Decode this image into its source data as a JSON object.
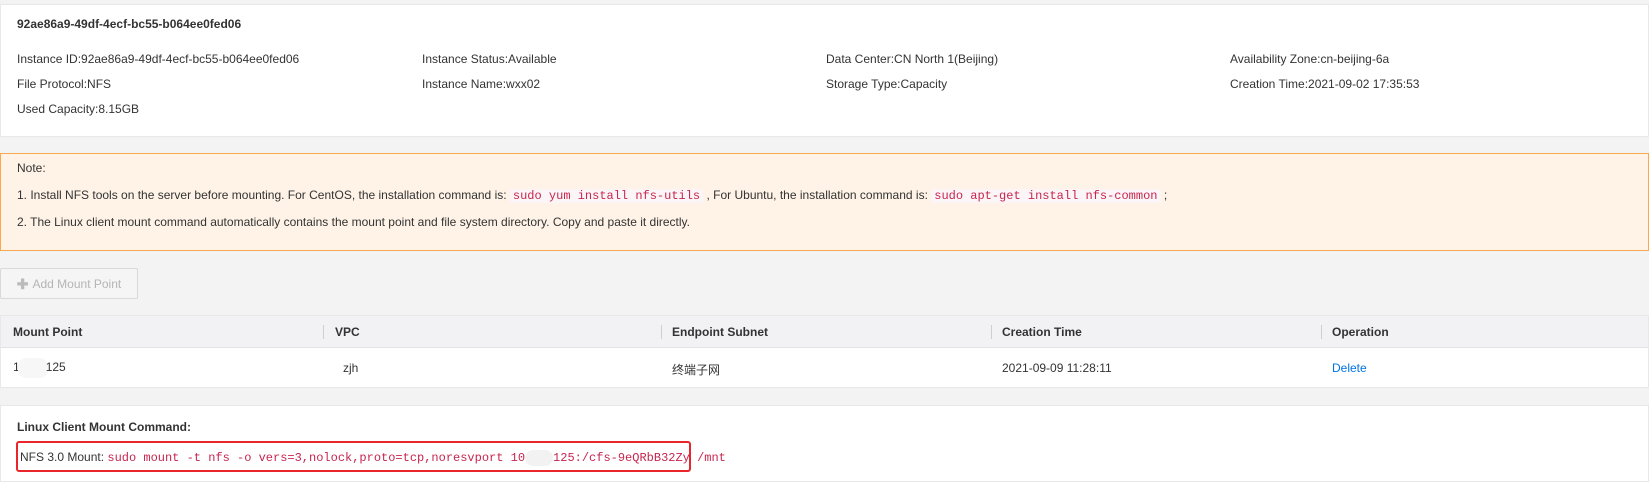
{
  "instance": {
    "title": "92ae86a9-49df-4ecf-bc55-b064ee0fed06",
    "instance_id": "Instance ID:92ae86a9-49df-4ecf-bc55-b064ee0fed06",
    "status": "Instance Status:Available",
    "data_center": "Data Center:CN North 1(Beijing)",
    "availability_zone": "Availability Zone:cn-beijing-6a",
    "file_protocol": "File Protocol:NFS",
    "instance_name": "Instance Name:wxx02",
    "storage_type": "Storage Type:Capacity",
    "creation_time": "Creation Time:2021-09-02 17:35:53",
    "used_capacity": "Used Capacity:8.15GB"
  },
  "note": {
    "heading": "Note:",
    "line1_prefix": "1. Install NFS tools on the server before mounting. For CentOS, the installation command is: ",
    "line1_cmd1": "sudo yum install nfs-utils",
    "line1_mid": " , For Ubuntu, the installation command is: ",
    "line1_cmd2": "sudo apt-get install nfs-common",
    "line1_suffix": " ;",
    "line2": "2. The Linux client mount command automatically contains the mount point and file system directory. Copy and paste it directly."
  },
  "toolbar": {
    "add_mount_point_label": "Add Mount Point",
    "add_icon": "plus-icon"
  },
  "table": {
    "headers": [
      "Mount Point",
      "VPC",
      "Endpoint Subnet",
      "Creation Time",
      "Operation"
    ],
    "rows": [
      {
        "mount_point_start": "1",
        "mount_point_end": "125",
        "vpc": "zjh",
        "subnet": "终端子网",
        "creation_time": "2021-09-09 11:28:11",
        "operation": "Delete"
      }
    ]
  },
  "mount_command": {
    "heading": "Linux Client Mount Command:",
    "label": "NFS 3.0 Mount: ",
    "cmd_start": "sudo mount -t nfs -o vers=3,nolock,proto=tcp,noresvport 10",
    "cmd_end": "125:/cfs-9eQRbB32Zy /mnt"
  },
  "colors": {
    "accent_link": "#0073e6",
    "note_border": "#f8a94f",
    "note_bg": "#fef3e6",
    "code_text": "#c7254e",
    "highlight_border": "#e8262b"
  }
}
